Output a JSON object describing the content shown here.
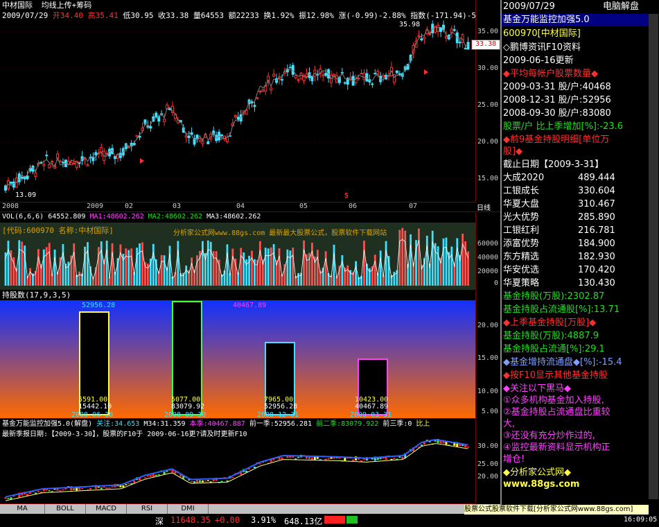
{
  "main_chart": {
    "stock_name": "中材国际",
    "indicator": "均线上传+筹码",
    "quote": {
      "date": "2009/07/29",
      "open_label": "开",
      "open": "34.40",
      "high_label": "高",
      "high": "35.41",
      "low_label": "低",
      "low": "30.95",
      "close_label": "收",
      "close": "33.38",
      "volume_label": "量",
      "volume": "64553",
      "amount_label": "额",
      "amount": "22233",
      "turnover_label": "换",
      "turnover": "1.92%",
      "amplitude_label": "振",
      "amplitude": "12.98%",
      "change_label": "涨",
      "change": "(-0.99)-2.88%",
      "index_label": "指数",
      "index": "(-171.94)-5"
    },
    "high_mark": "35.98",
    "low_mark": "13.09",
    "last_price_tag": "33.38",
    "y_ticks": [
      "35.00",
      "30.00",
      "25.00",
      "20.00",
      "15.00"
    ],
    "x_labels": [
      "2008",
      "2009",
      "02",
      "03",
      "04",
      "05",
      "06",
      "07"
    ],
    "period_label": "日线",
    "signal_marker": "S"
  },
  "volume_chart": {
    "title": "VOL(6,6,6)",
    "vol": "64552.809",
    "ma1_label": "MA1:",
    "ma1": "48602.262",
    "ma2_label": "MA2:",
    "ma2": "48602.262",
    "ma3_label": "MA3:",
    "ma3": "48602.262",
    "overlay_text": "[代码:600970 名称:中材国际]",
    "watermark": "分析家公式网www.88gs.com 最新最大股票公式，股票软件下载网站",
    "y_ticks": [
      "60000",
      "40000",
      "20000",
      "0"
    ]
  },
  "holders_chart": {
    "title": "持股数(17,9,3,5)",
    "y_ticks": [
      "20.00",
      "15.00",
      "10.00",
      "5.00"
    ],
    "top_labels": [
      "52956.28",
      "40467.89"
    ],
    "bars": [
      {
        "color": "#ffff40",
        "v1": "5591.00",
        "v2": "15442.10",
        "date": "2008-06-30"
      },
      {
        "color": "#40ff40",
        "v1": "5077.00",
        "v2": "83079.92",
        "date": "2008-09-30"
      },
      {
        "color": "#40e0ff",
        "v1": "7965.00",
        "v2": "52956.28",
        "date": "2008-12-31"
      },
      {
        "color": "#ff40ff",
        "v1": "10423.00",
        "v2": "40467.89",
        "date": "2009-03-31"
      }
    ]
  },
  "fund_chart": {
    "title": "基金万能监控加强5.0(解盘)",
    "focus": "关注:34.653",
    "m34": "M34:31.359",
    "this_q": "本季:40467.887",
    "q1": "前一季:52956.281",
    "q2": "前二季:83079.922",
    "q3": "前三季:0",
    "more": "比上",
    "notice": "最新季报日期:【2009-3-30】，股票的F10于 2009-06-16更?请及时更新F10",
    "y_ticks": [
      "30.00",
      "25.00",
      "20.00"
    ]
  },
  "tabs": [
    "MA",
    "BOLL",
    "MACD",
    "RSI",
    "DMI"
  ],
  "status_bar": {
    "market": "深",
    "index_value": "11648.35",
    "index_change": "+0.00",
    "pct": "3.91%",
    "amount": "648.13亿",
    "ad_text": "股票公式股票软件下载[分析家公式网www.88gs.com]",
    "time": "16:09:05"
  },
  "sidebar": {
    "date": "2009/07/29",
    "mode": "电脑解盘",
    "title": "基金万能监控加强5.0",
    "code": "600970[中材国际]",
    "f10": "◇鹏博资讯F10资料",
    "update": "2009-06-16更新",
    "avg_head": "◆平均每帐户股票数量◆",
    "avg_rows": [
      "2009-03-31 股/户:40468",
      "2008-12-31 股/户:52956",
      "2008-09-30 股/户:83080"
    ],
    "avg_change": "股票/户 比上季增加[%]:-23.6",
    "top9_head": "◆前9基金持股明细[单位万",
    "top9_head2": "股]◆",
    "cutoff": "截止日期【2009-3-31】",
    "funds": [
      {
        "name": "大成2020",
        "value": "489.444"
      },
      {
        "name": "工银成长",
        "value": "330.604"
      },
      {
        "name": "华夏大盘",
        "value": "310.467"
      },
      {
        "name": "光大优势",
        "value": "285.890"
      },
      {
        "name": "工银红利",
        "value": "216.781"
      },
      {
        "name": "添富优势",
        "value": "184.900"
      },
      {
        "name": "东方精选",
        "value": "182.930"
      },
      {
        "name": "华安优选",
        "value": "170.420"
      },
      {
        "name": "华夏策略",
        "value": "130.430"
      }
    ],
    "hold1": "基金持股(万股):2302.87",
    "hold1_pct": "基金持股占流通股[%]:13.71",
    "prev_head": "◆上季基金持股[万股]◆",
    "hold2": "基金持股(万股):4887.9",
    "hold2_pct": "基金持股占流通[%]:29.1",
    "incr": "◆基金增持流通盘◆[%]:-15.4",
    "f10_more": "◆按F10显示其他基金持股",
    "watch_head": "◆关注以下黑马◆",
    "watch1": "①众多机构基金加入持股,",
    "watch2a": "②基金持股占流通盘比重较",
    "watch2b": "大,",
    "watch3": "③还没有充分炒作过的,",
    "watch4a": "④监控最新资料显示机构正",
    "watch4b": "增仓!",
    "site_head": "◆分析家公式网◆",
    "site": "www.88gs.com"
  }
}
